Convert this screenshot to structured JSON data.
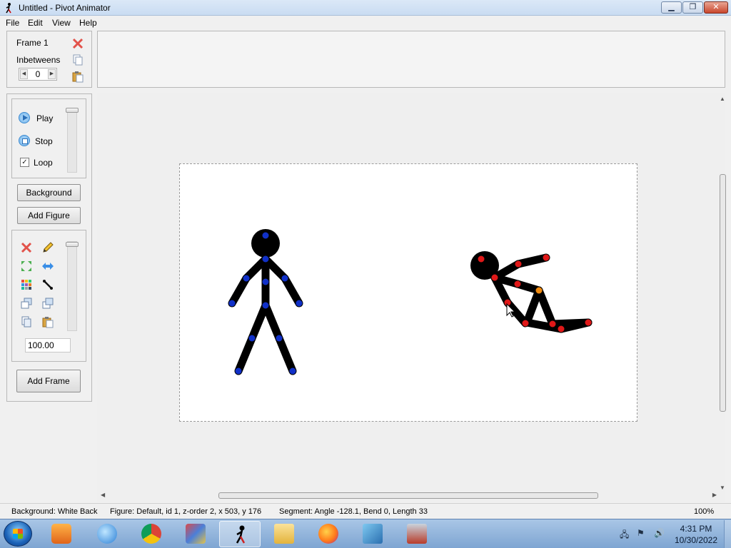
{
  "window": {
    "title": "Untitled - Pivot Animator",
    "min_label": "▁",
    "max_label": "❐",
    "close_label": "✕"
  },
  "menu": [
    "File",
    "Edit",
    "View",
    "Help"
  ],
  "frame_panel": {
    "frame_label": "Frame 1",
    "inbetweens_label": "Inbetweens",
    "inbetweens_value": "0"
  },
  "playback": {
    "play_label": "Play",
    "stop_label": "Stop",
    "loop_label": "Loop",
    "loop_checked": "✓"
  },
  "buttons": {
    "background": "Background",
    "add_figure": "Add Figure",
    "add_frame": "Add Frame"
  },
  "tools": {
    "scale_value": "100.00"
  },
  "figures": {
    "blue_joint_color": "#1030c8",
    "red_joint_color": "#e01818",
    "orange_joint_color": "#f08a10"
  },
  "status": {
    "background": "Background: White Back",
    "figure": "Figure: Default,  id 1,  z-order 2,  x 503, y 176",
    "segment": "Segment: Angle -128.1,  Bend 0,  Length 33",
    "zoom": "100%"
  },
  "taskbar": {
    "apps": [
      "windows-media-player",
      "thunderbird",
      "google-chrome",
      "game-app",
      "pivot-animator",
      "file-explorer",
      "firefox",
      "paint-app",
      "photo-viewer"
    ],
    "time": "4:31 PM",
    "date": "10/30/2022"
  }
}
